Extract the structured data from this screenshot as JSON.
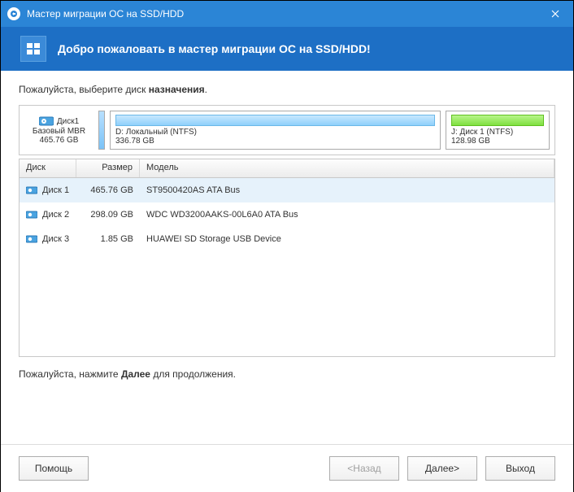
{
  "titlebar": {
    "title": "Мастер миграции ОС на SSD/HDD"
  },
  "banner": {
    "text": "Добро пожаловать в мастер миграции ОС на SSD/HDD!"
  },
  "instruction": {
    "prefix": "Пожалуйста, выберите диск ",
    "bold": "назначения",
    "suffix": "."
  },
  "disk_panel": {
    "label": "Диск1",
    "type": "Базовый MBR",
    "size": "465.76 GB",
    "partitions": [
      {
        "name": "D: Локальный (NTFS)",
        "size": "336.78 GB"
      },
      {
        "name": "J: Диск 1 (NTFS)",
        "size": "128.98 GB"
      }
    ]
  },
  "grid": {
    "headers": {
      "disk": "Диск",
      "size": "Размер",
      "model": "Модель"
    },
    "rows": [
      {
        "disk": "Диск 1",
        "size": "465.76 GB",
        "model": "ST9500420AS ATA Bus",
        "selected": true
      },
      {
        "disk": "Диск 2",
        "size": "298.09 GB",
        "model": "WDC WD3200AAKS-00L6A0 ATA Bus",
        "selected": false
      },
      {
        "disk": "Диск 3",
        "size": "1.85 GB",
        "model": "HUAWEI   SD Storage         USB Device",
        "selected": false
      }
    ]
  },
  "footer": {
    "prefix": "Пожалуйста, нажмите ",
    "bold": "Далее",
    "suffix": " для продолжения."
  },
  "buttons": {
    "help": "Помощь",
    "back": "<Назад",
    "next": "Далее>",
    "exit": "Выход"
  }
}
